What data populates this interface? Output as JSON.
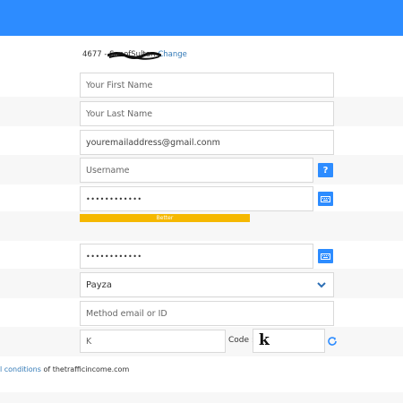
{
  "referral": {
    "id_prefix": "4677 - ",
    "username": "SonofSultan",
    "change_label": "Change"
  },
  "fields": {
    "first_name_placeholder": "Your First Name",
    "last_name_placeholder": "Your Last Name",
    "email_value": "youremailaddress@gmail.conm",
    "username_placeholder": "Username",
    "password_value": "••••••••••••",
    "password_strength_label": "Better",
    "confirm_password_value": "••••••••••••",
    "payment_method_selected": "Payza",
    "method_email_placeholder": "Method email or ID",
    "captcha_input_value": "K",
    "code_label": "Code :",
    "captcha_text": "k"
  },
  "help_icon_glyph": "?",
  "terms": {
    "link_text": "l conditions",
    "suffix": " of thetrafficincome.com"
  },
  "colors": {
    "accent": "#2d8cff",
    "strength_bar": "#f5b800",
    "link": "#337ab7"
  }
}
